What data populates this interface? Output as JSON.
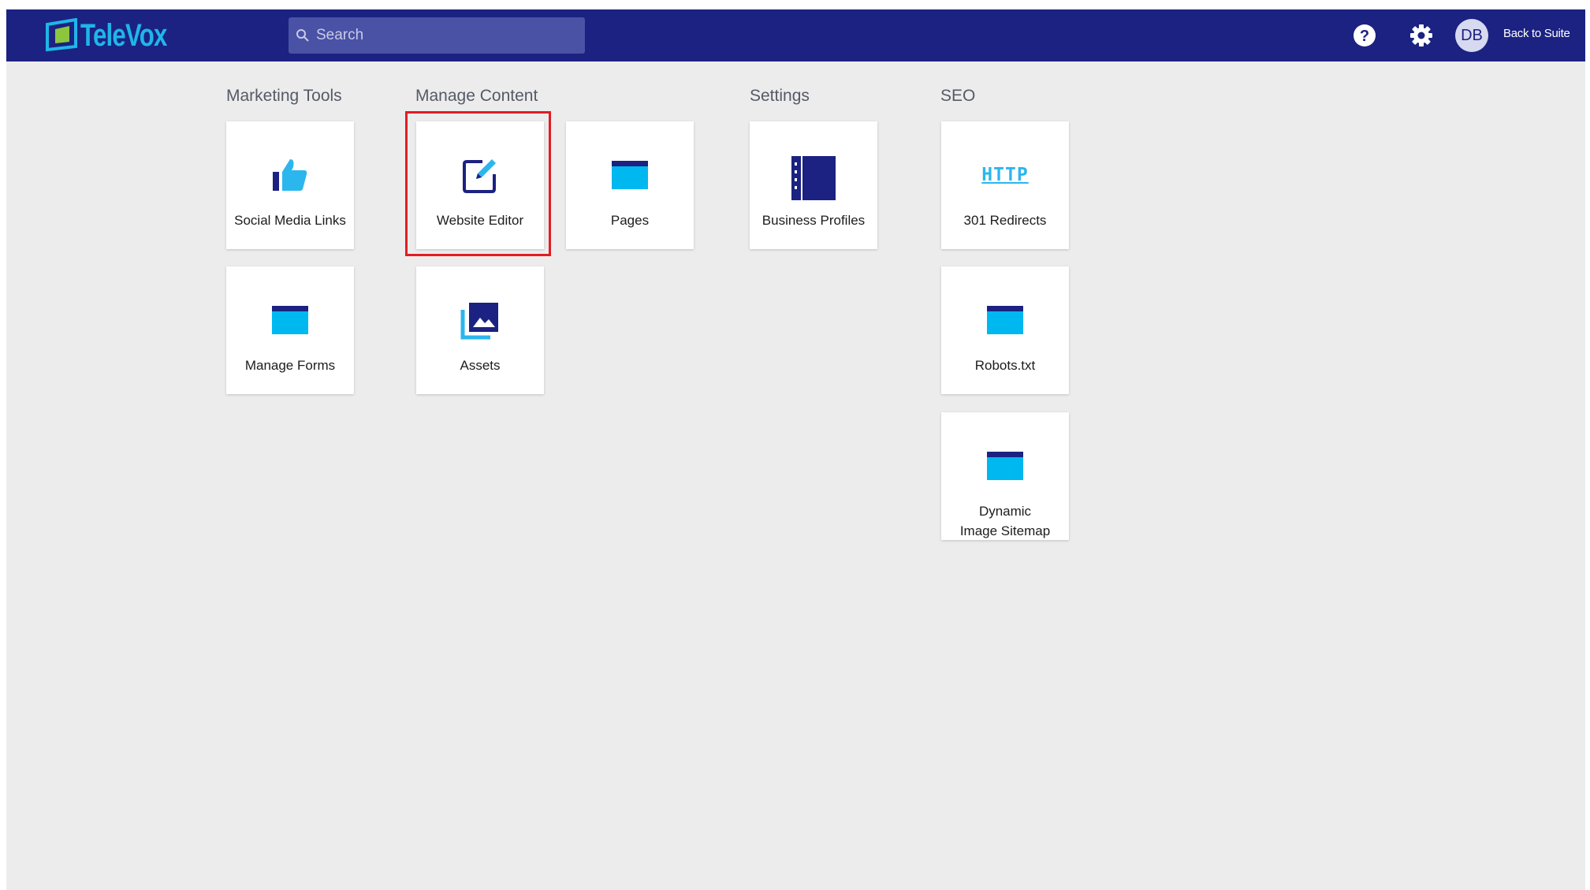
{
  "header": {
    "logo_text": "TeleVox",
    "search_placeholder": "Search",
    "avatar_initials": "DB",
    "back_label": "Back to Suite"
  },
  "sections": [
    {
      "title": "Marketing Tools",
      "tiles": [
        {
          "label": "Social Media Links",
          "icon": "thumbs-up-icon"
        },
        {
          "label": "Manage Forms",
          "icon": "window-icon"
        }
      ]
    },
    {
      "title": "Manage Content",
      "tiles": [
        {
          "label": "Website Editor",
          "icon": "edit-icon"
        },
        {
          "label": "Pages",
          "icon": "window-icon"
        },
        {
          "label": "Assets",
          "icon": "image-library-icon"
        }
      ]
    },
    {
      "title": "Settings",
      "tiles": [
        {
          "label": "Business Profiles",
          "icon": "notebook-icon"
        }
      ]
    },
    {
      "title": "SEO",
      "tiles": [
        {
          "label": "301 Redirects",
          "icon": "http-icon",
          "icon_text": "HTTP"
        },
        {
          "label": "Robots.txt",
          "icon": "window-icon"
        },
        {
          "label": "Dynamic Image Sitemap",
          "icon": "window-icon"
        }
      ]
    }
  ],
  "colors": {
    "header_bg": "#1b2281",
    "accent_light": "#1fb6e9",
    "page_bg": "#ececec",
    "highlight": "#e31c23"
  }
}
